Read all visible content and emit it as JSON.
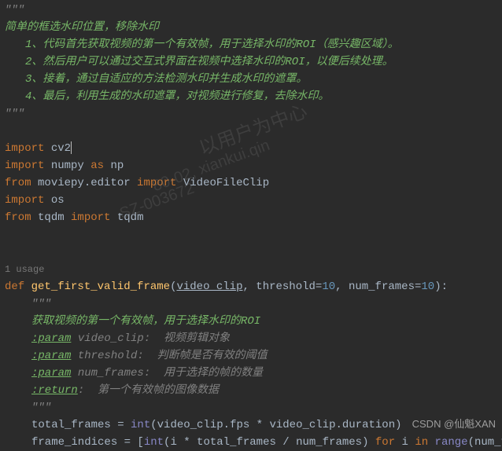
{
  "doc": {
    "intro": "简单的框选水印位置，移除水印",
    "step1_num": "1、",
    "step1": "代码首先获取视频的第一个有效帧，用于选择水印的ROI（感兴趣区域）。",
    "step2_num": "2、",
    "step2": "然后用户可以通过交互式界面在视频中选择水印的ROI，以便后续处理。",
    "step3_num": "3、",
    "step3": "接着，通过自适应的方法检测水印并生成水印的遮罩。",
    "step4_num": "4、",
    "step4": "最后，利用生成的水印遮罩，对视频进行修复，去除水印。",
    "triple_quote": "\"\"\""
  },
  "imports": {
    "import_kw": "import",
    "cv2": "cv2",
    "numpy": "numpy",
    "as_kw": "as",
    "np": "np",
    "from_kw": "from",
    "moviepy": "moviepy.editor",
    "videoclip": "VideoFileClip",
    "os": "os",
    "tqdm_mod": "tqdm",
    "tqdm_fn": "tqdm"
  },
  "usage_hint": "1 usage",
  "func": {
    "def_kw": "def",
    "name": "get_first_valid_frame",
    "lparen": "(",
    "param_video": "video_clip",
    "comma1": ", ",
    "param_thresh": "threshold",
    "eq": "=",
    "thresh_val": "10",
    "comma2": ", ",
    "param_numf": "num_frames",
    "numf_val": "10",
    "rparen_colon": "):",
    "docstring": {
      "triple_quote": "\"\"\"",
      "desc": "获取视频的第一个有效帧，用于选择水印的ROI",
      "param_tag": ":param",
      "video_clip_label": " video_clip: ",
      "video_clip_desc": " 视频剪辑对象",
      "threshold_label": " threshold: ",
      "threshold_desc": " 判断帧是否有效的阈值",
      "num_frames_label": " num_frames: ",
      "num_frames_desc": " 用于选择的帧的数量",
      "return_tag": ":return",
      "return_colon": ": ",
      "return_desc": " 第一个有效帧的图像数据"
    },
    "body": {
      "total_frames": "total_frames = ",
      "int_fn": "int",
      "tf_expr": "(video_clip.fps * video_clip.duration)",
      "frame_indices": "frame_indices = [",
      "fi_expr1": "(i * total_frames / num_frames) ",
      "for_kw": "for",
      "i_var": " i ",
      "in_kw": "in",
      "range_fn": " range",
      "range_arg": "(num_fram"
    }
  },
  "watermarks": {
    "wm1": "以用户为中心",
    "wm2": "80-02, xiankui.qin",
    "wm3": "SZ-003672"
  },
  "credit": "CSDN @仙魁XAN"
}
